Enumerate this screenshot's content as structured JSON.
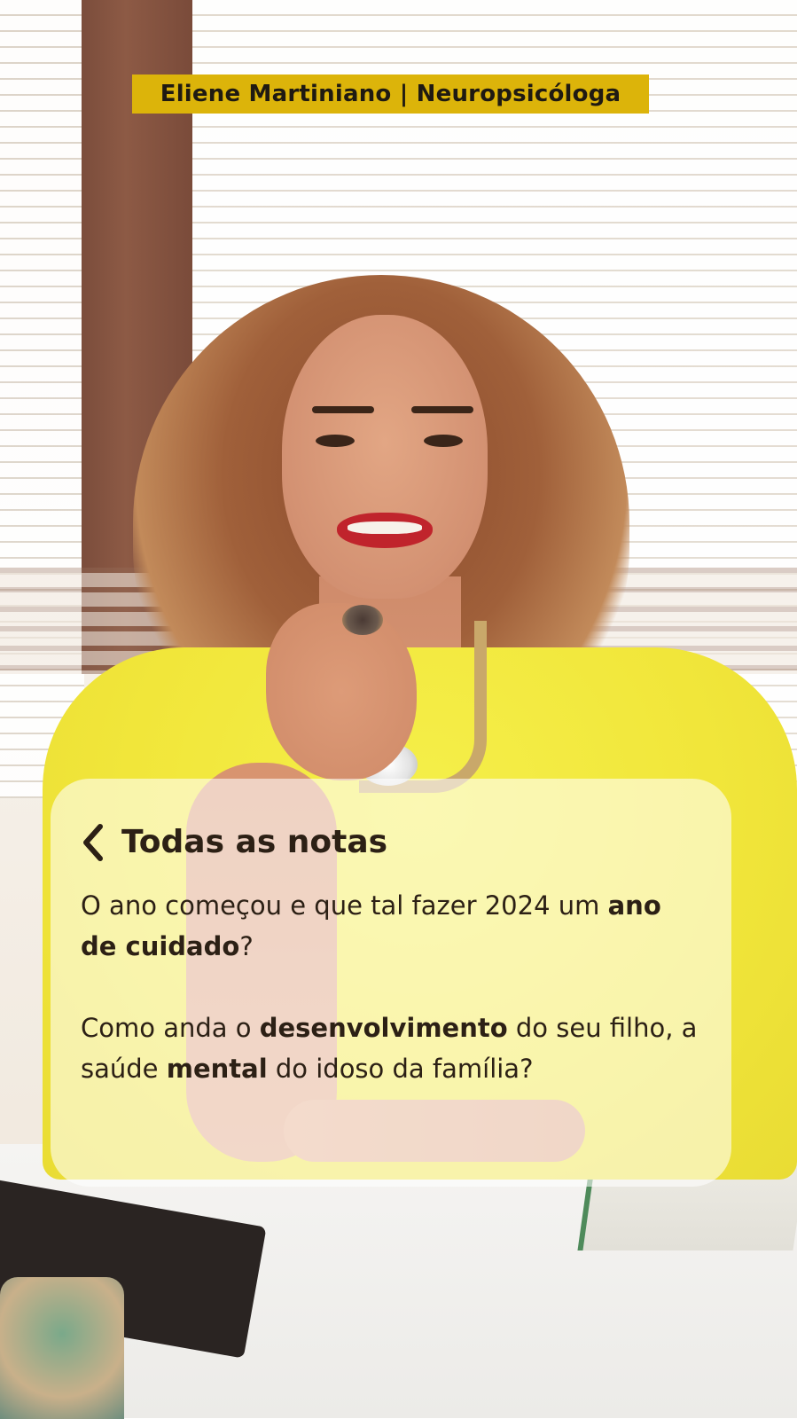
{
  "header": {
    "title": "Eliene Martiniano | Neuropsicóloga"
  },
  "note": {
    "back_label": "Todas as notas",
    "back_icon": "chevron-left-icon",
    "paragraph1": {
      "text1": "O ano começou e que tal fazer 2024 um ",
      "bold1": "ano de cuidado",
      "text2": "?"
    },
    "paragraph2": {
      "text1": "Como anda o ",
      "bold1": "desenvolvimento",
      "text2": " do seu filho, a saúde ",
      "bold2": "mental",
      "text3": " do idoso da família?"
    }
  },
  "colors": {
    "badge": "#dcb40a",
    "text": "#2c2015",
    "shirt": "#f1e63a"
  }
}
